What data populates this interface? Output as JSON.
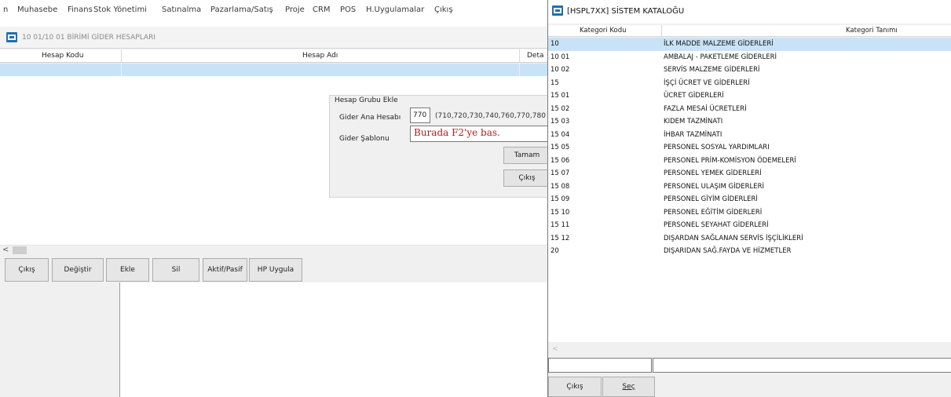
{
  "menubar": {
    "items": [
      "n",
      "Muhasebe",
      "Finans",
      "Stok Yönetimi",
      "Satınalma",
      "Pazarlama/Satış",
      "Proje",
      "CRM",
      "POS",
      "H.Uygulamalar",
      "Çıkış"
    ]
  },
  "main": {
    "title": "10 01/10 01 BİRİMİ GİDER HESAPLARI",
    "columns": [
      "Hesap Kodu",
      "Hesap Adı",
      "Deta"
    ],
    "group": {
      "title": "Hesap Grubu Ekle",
      "ana_label": "Gider Ana Hesabı",
      "ana_value": "770",
      "ana_list": "(710,720,730,740,760,770,780",
      "sablon_label": "Gider Şablonu",
      "sablon_hint": "Burada F2'ye bas.",
      "ok_label": "Tamam",
      "cancel_label": "Çıkış"
    },
    "scroll_left": "<",
    "toolbar": [
      "Çıkış",
      "Değiştir",
      "Ekle",
      "Sil",
      "Aktif/Pasif",
      "HP Uygula"
    ]
  },
  "catalog": {
    "title": "[HSPL7XX] SİSTEM KATALOĞU",
    "columns": [
      "Kategori Kodu",
      "Kategori Tanımı"
    ],
    "rows": [
      [
        "10",
        "İLK MADDE MALZEME GİDERLERİ"
      ],
      [
        "10 01",
        "AMBALAJ - PAKETLEME GİDERLERİ"
      ],
      [
        "10 02",
        "SERVİS MALZEME GİDERLERİ"
      ],
      [
        "15",
        "İŞÇİ ÜCRET VE GİDERLERİ"
      ],
      [
        "15 01",
        "ÜCRET GİDERLERİ"
      ],
      [
        "15 02",
        "FAZLA MESAİ ÜCRETLERİ"
      ],
      [
        "15 03",
        "KIDEM TAZMİNATI"
      ],
      [
        "15 04",
        "İHBAR TAZMİNATI"
      ],
      [
        "15 05",
        "PERSONEL SOSYAL YARDIMLARI"
      ],
      [
        "15 06",
        "PERSONEL PRİM-KOMİSYON ÖDEMELERİ"
      ],
      [
        "15 07",
        "PERSONEL YEMEK GİDERLERİ"
      ],
      [
        "15 08",
        "PERSONEL ULAŞIM GİDERLERİ"
      ],
      [
        "15 09",
        "PERSONEL GİYİM GİDERLERİ"
      ],
      [
        "15 10",
        "PERSONEL EĞİTİM GİDERLERİ"
      ],
      [
        "15 11",
        "PERSONEL SEYAHAT GİDERLERİ"
      ],
      [
        "15 12",
        "DIŞARDAN SAĞLANAN SERVİS İŞÇİLİKLERİ"
      ],
      [
        "20",
        "DIŞARIDAN SAĞ.FAYDA VE HİZMETLER"
      ]
    ],
    "selected_index": 0,
    "scroll_left": "<",
    "exit_label": "Çıkış",
    "select_label": "Seç",
    "selection_color": "#c8e3f8",
    "icon": "window-app-icon"
  }
}
